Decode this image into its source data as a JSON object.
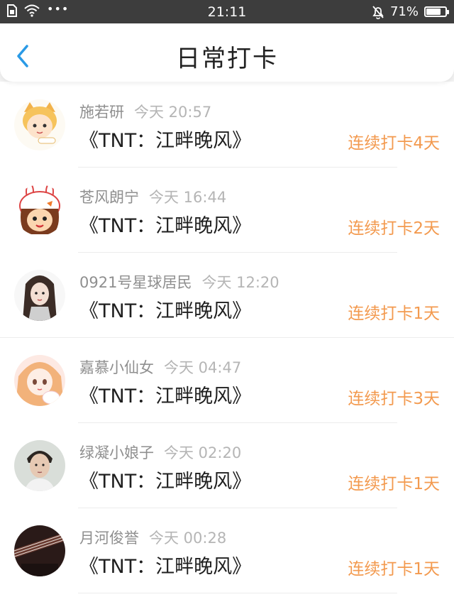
{
  "status_bar": {
    "time": "21:11",
    "battery": "71%",
    "battery_level": 0.71,
    "icons": [
      "sim-icon",
      "wifi-icon",
      "more-dots-icon",
      "mute-bell-icon",
      "battery-icon"
    ]
  },
  "header": {
    "title": "日常打卡",
    "back_icon": "chevron-left-icon"
  },
  "colors": {
    "accent_orange": "#f39a4f",
    "back_blue": "#2a9ae6",
    "status_bg": "#3d3d3d"
  },
  "entries": [
    {
      "name": "施若研",
      "time": "今天 20:57",
      "book": "《TNT：江畔晚风》",
      "streak": "连续打卡4天"
    },
    {
      "name": "苍风朗宁",
      "time": "今天 16:44",
      "book": "《TNT：江畔晚风》",
      "streak": "连续打卡2天"
    },
    {
      "name": "0921号星球居民",
      "time": "今天 12:20",
      "book": "《TNT：江畔晚风》",
      "streak": "连续打卡1天"
    },
    {
      "name": "嘉慕小仙女",
      "time": "今天 04:47",
      "book": "《TNT：江畔晚风》",
      "streak": "连续打卡3天"
    },
    {
      "name": "绿凝小娘子",
      "time": "今天 02:20",
      "book": "《TNT：江畔晚风》",
      "streak": "连续打卡1天"
    },
    {
      "name": "月河俊誉",
      "time": "今天 00:28",
      "book": "《TNT：江畔晚风》",
      "streak": "连续打卡1天"
    }
  ]
}
